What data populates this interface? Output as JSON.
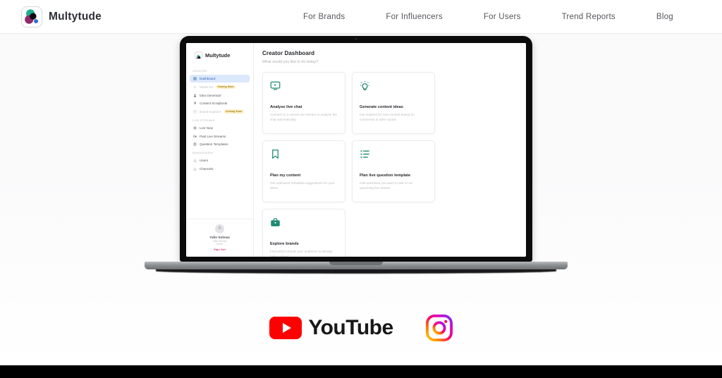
{
  "site": {
    "brand_name": "Multytude",
    "logo_icon": "multytude-circles-logo",
    "nav": [
      {
        "label": "For Brands"
      },
      {
        "label": "For Influencers"
      },
      {
        "label": "For Users"
      },
      {
        "label": "Trend Reports"
      },
      {
        "label": "Blog"
      }
    ]
  },
  "colors": {
    "accent_teal": "#1f8a72",
    "active_nav_bg": "#dce8fb",
    "active_nav_text": "#2e62b8",
    "badge_bg": "#fdefc4",
    "badge_text": "#9a7614",
    "signout": "#d4497f",
    "youtube_red": "#ff0000",
    "hero_bg": "#fafafb"
  },
  "app": {
    "brand_name": "Multytude",
    "title": "Creator Dashboard",
    "subtitle": "What would you like to do today?",
    "sidebar": {
      "sections": [
        {
          "label": "CREATOR",
          "items": [
            {
              "label": "Dashboard",
              "icon": "grid-icon",
              "state": "active",
              "badge": ""
            },
            {
              "label": "Media Kit",
              "icon": "sparkle-icon",
              "state": "disabled",
              "badge": "Coming Soon"
            },
            {
              "label": "Idea Generator",
              "icon": "person-icon",
              "state": "default",
              "badge": ""
            },
            {
              "label": "Content Scrapbook",
              "icon": "pin-icon",
              "state": "default",
              "badge": ""
            },
            {
              "label": "Brand Explorer",
              "icon": "layers-icon",
              "state": "disabled",
              "badge": "Coming Soon"
            }
          ]
        },
        {
          "label": "LIVE STREAMS",
          "items": [
            {
              "label": "Live Now",
              "icon": "broadcast-icon",
              "state": "default",
              "badge": ""
            },
            {
              "label": "Past Live Streams",
              "icon": "video-icon",
              "state": "default",
              "badge": ""
            },
            {
              "label": "Question Templates",
              "icon": "clipboard-icon",
              "state": "default",
              "badge": ""
            }
          ]
        },
        {
          "label": "MANAGEMENT",
          "items": [
            {
              "label": "Users",
              "icon": "users-icon",
              "state": "default",
              "badge": ""
            },
            {
              "label": "Channels",
              "icon": "channels-icon",
              "state": "default",
              "badge": ""
            }
          ]
        }
      ],
      "profile": {
        "avatar_initial": "A",
        "name": "Yalin Solmaz",
        "email": "Yalin Solmaz",
        "role": "Owner",
        "sign_out_label": "Sign Out"
      }
    },
    "cards": [
      {
        "icon": "monitor-play-icon",
        "title": "Analyse live chat",
        "description": "Connect to a current live stream to analyse the chat automatically"
      },
      {
        "icon": "lightbulb-icon",
        "title": "Generate content ideas",
        "description": "Get inspired for new content based on comments or other inputs"
      },
      {
        "icon": "bookmark-icon",
        "title": "Plan my content",
        "description": "Get optimised metadata suggestions for your ideas"
      },
      {
        "icon": "list-icon",
        "title": "Plan live question template",
        "description": "Add questions you want to ask on an upcoming live stream"
      },
      {
        "icon": "briefcase-icon",
        "title": "Explore brands",
        "description": "Find which brands your audience is already talking about"
      }
    ]
  },
  "socials": [
    {
      "name": "youtube",
      "label": "YouTube"
    },
    {
      "name": "instagram",
      "label": "Instagram"
    }
  ]
}
